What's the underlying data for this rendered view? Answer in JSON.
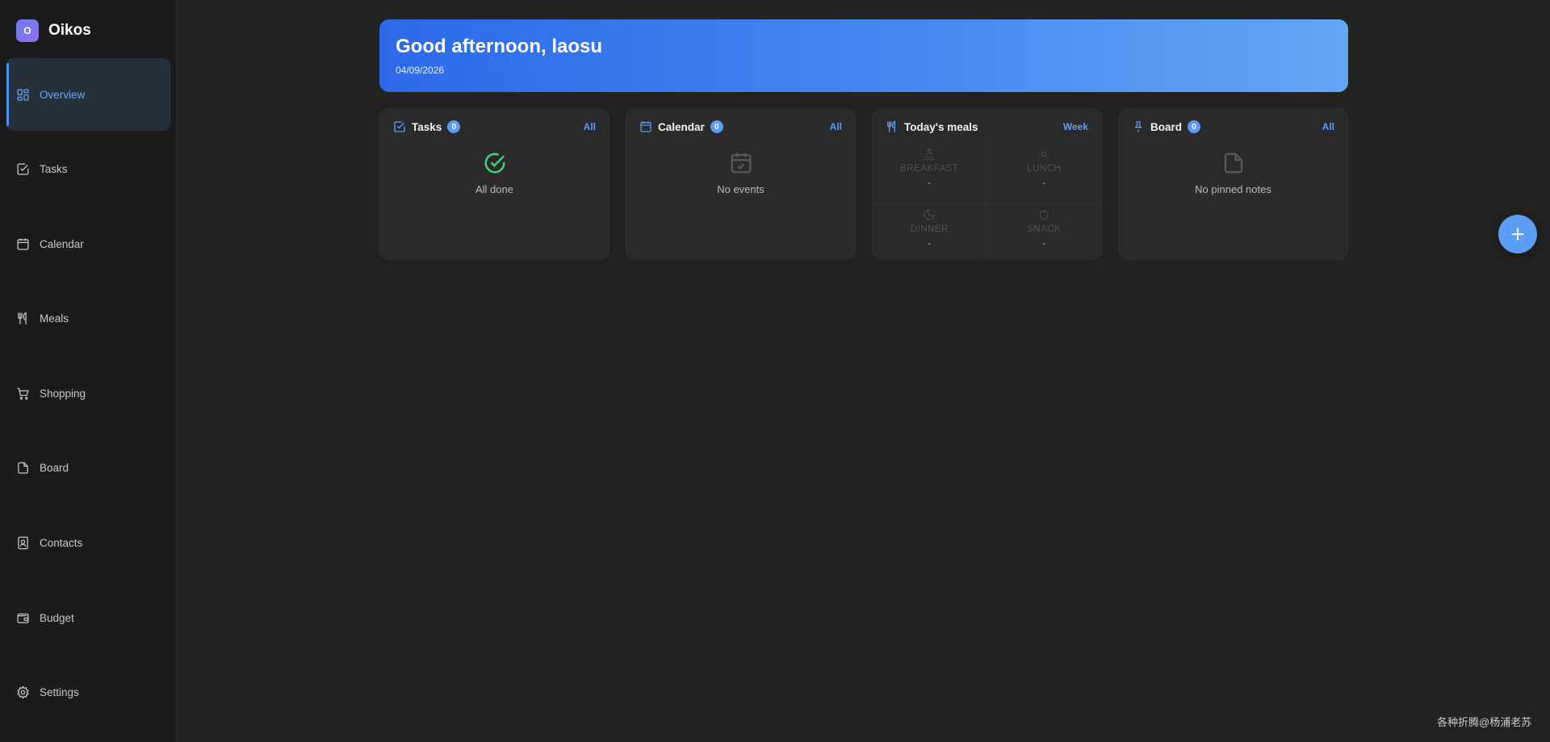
{
  "brand": {
    "initial": "O",
    "name": "Oikos"
  },
  "nav": [
    {
      "label": "Overview",
      "icon": "overview-icon",
      "active": true
    },
    {
      "label": "Tasks",
      "icon": "tasks-icon"
    },
    {
      "label": "Calendar",
      "icon": "calendar-icon"
    },
    {
      "label": "Meals",
      "icon": "meals-icon"
    },
    {
      "label": "Shopping",
      "icon": "cart-icon"
    },
    {
      "label": "Board",
      "icon": "note-icon"
    },
    {
      "label": "Contacts",
      "icon": "contacts-icon"
    },
    {
      "label": "Budget",
      "icon": "wallet-icon"
    },
    {
      "label": "Settings",
      "icon": "gear-icon"
    }
  ],
  "banner": {
    "title": "Good afternoon, laosu",
    "date": "04/09/2026"
  },
  "cards": {
    "tasks": {
      "title": "Tasks",
      "count": "0",
      "link": "All",
      "empty_text": "All done"
    },
    "calendar": {
      "title": "Calendar",
      "count": "0",
      "link": "All",
      "empty_text": "No events"
    },
    "meals": {
      "title": "Today's meals",
      "link": "Week",
      "slots": [
        {
          "name": "BREAKFAST",
          "value": "-"
        },
        {
          "name": "LUNCH",
          "value": "-"
        },
        {
          "name": "DINNER",
          "value": "-"
        },
        {
          "name": "SNACK",
          "value": "-"
        }
      ]
    },
    "board": {
      "title": "Board",
      "count": "0",
      "link": "All",
      "empty_text": "No pinned notes"
    }
  },
  "watermark": "各种折腾@杨浦老苏",
  "colors": {
    "accent": "#5d9ef5",
    "success": "#4ccf7a",
    "sidebar_bg": "#1b1b1b",
    "page_bg": "#222221"
  }
}
